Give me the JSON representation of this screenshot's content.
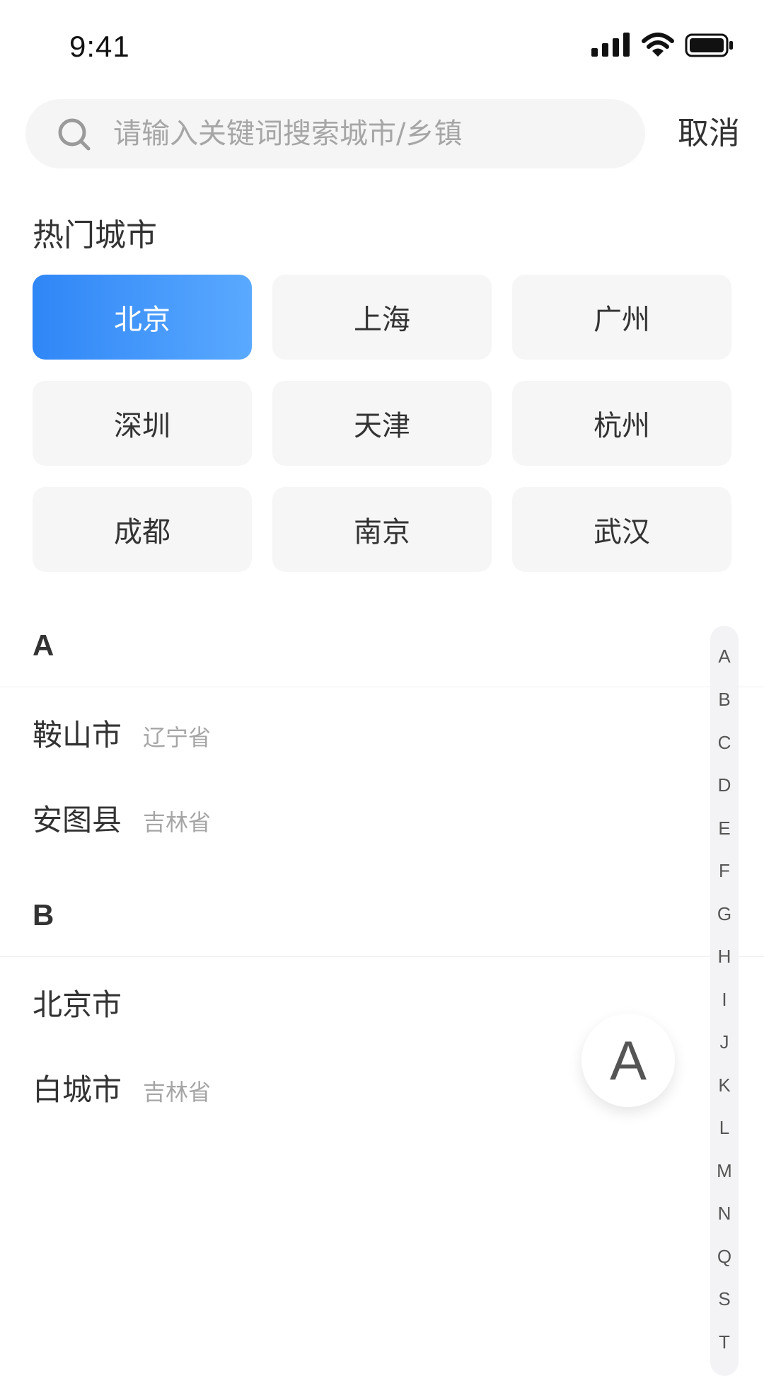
{
  "status_bar": {
    "time": "9:41"
  },
  "search": {
    "placeholder": "请输入关键词搜索城市/乡镇",
    "value": "",
    "cancel_label": "取消"
  },
  "hot_cities": {
    "title": "热门城市",
    "items": [
      {
        "label": "北京",
        "selected": true
      },
      {
        "label": "上海"
      },
      {
        "label": "广州"
      },
      {
        "label": "深圳"
      },
      {
        "label": "天津"
      },
      {
        "label": "杭州"
      },
      {
        "label": "成都"
      },
      {
        "label": "南京"
      },
      {
        "label": "武汉"
      }
    ]
  },
  "city_list": {
    "sections": [
      {
        "letter": "A",
        "cities": [
          {
            "name": "鞍山市",
            "province": "辽宁省"
          },
          {
            "name": "安图县",
            "province": "吉林省"
          }
        ]
      },
      {
        "letter": "B",
        "cities": [
          {
            "name": "北京市",
            "province": ""
          },
          {
            "name": "白城市",
            "province": "吉林省"
          }
        ]
      }
    ]
  },
  "alphabet_index": [
    "A",
    "B",
    "C",
    "D",
    "E",
    "F",
    "G",
    "H",
    "I",
    "J",
    "K",
    "L",
    "M",
    "N",
    "Q",
    "S",
    "T"
  ],
  "letter_bubble": "A",
  "colors": {
    "accent": "#2f86f6",
    "text": "#333333",
    "muted": "#a6a6a6",
    "chip_bg": "#f6f6f6"
  }
}
